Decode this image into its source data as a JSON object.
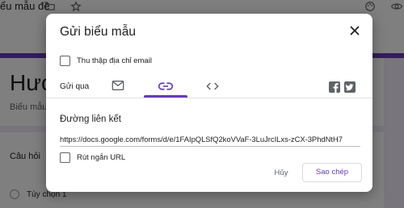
{
  "background": {
    "doc_title_fragment": "ểu mẫu đề",
    "form_title_fragment": "Hướn",
    "form_desc_fragment": "Biểu mẫu",
    "question_fragment": "Câu hỏi",
    "option_label": "Tùy chọn 1",
    "icons": [
      "folder-icon",
      "star-icon",
      "palette-icon",
      "preview-eye-icon"
    ]
  },
  "dialog": {
    "title": "Gửi biểu mẫu",
    "collect_email_label": "Thu thập địa chỉ email",
    "collect_email_checked": false,
    "send_via_label": "Gửi qua",
    "tabs": [
      {
        "name": "email",
        "icon": "mail-icon",
        "selected": false
      },
      {
        "name": "link",
        "icon": "link-icon",
        "selected": true
      },
      {
        "name": "embed",
        "icon": "embed-code-icon",
        "selected": false
      }
    ],
    "share_icons": [
      "facebook-icon",
      "twitter-icon"
    ],
    "link_section_title": "Đường liên kết",
    "link_url": "https://docs.google.com/forms/d/e/1FAIpQLSfQ2koVVaF-3LuJrcILxs-zCX-3PhdNtH7",
    "shorten_label": "Rút ngắn URL",
    "shorten_checked": false,
    "cancel_label": "Hủy",
    "copy_label": "Sao chép"
  },
  "colors": {
    "accent": "#673ab7",
    "icon": "#5f6368",
    "text": "#202124"
  }
}
